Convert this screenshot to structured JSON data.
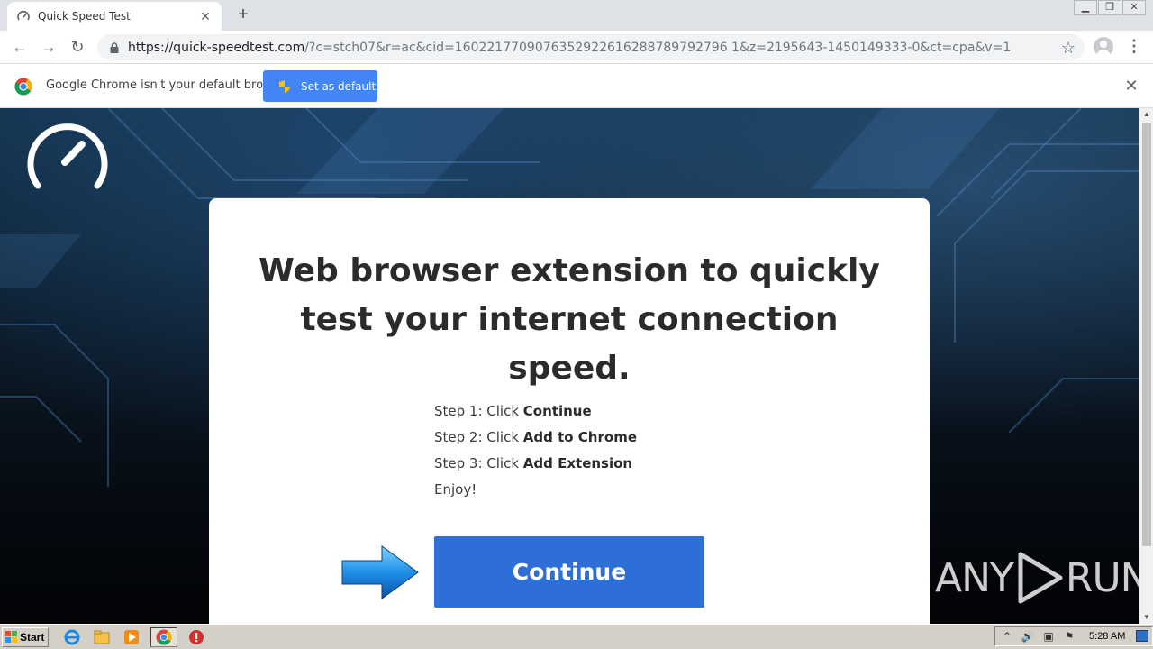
{
  "browser": {
    "tab": {
      "title": "Quick Speed Test"
    },
    "url": {
      "host": "https://quick-speedtest.com",
      "rest": "/?c=stch07&r=ac&cid=1602217709076352922616288789792796 1&z=2195643-1450149333-0&ct=cpa&v=1"
    },
    "infobar": {
      "message": "Google Chrome isn't your default browser",
      "button_label": "Set as default"
    }
  },
  "page": {
    "headline": "Web browser extension to quickly test your internet connection speed.",
    "steps": [
      {
        "prefix": "Step 1: Click ",
        "action": "Continue"
      },
      {
        "prefix": "Step 2: Click ",
        "action": "Add to Chrome"
      },
      {
        "prefix": "Step 3: Click ",
        "action": "Add Extension"
      }
    ],
    "closing": "Enjoy!",
    "cta_label": "Continue",
    "watermark": {
      "left": "ANY",
      "right": "RUN"
    }
  },
  "taskbar": {
    "start_label": "Start",
    "clock": "5:28 AM"
  },
  "colors": {
    "accent_blue": "#2d6fd6",
    "infobar_button": "#4285f4"
  },
  "icons": [
    "speedometer-icon",
    "lock-icon",
    "star-icon",
    "chrome-icon",
    "shield-icon",
    "arrow-icon"
  ]
}
